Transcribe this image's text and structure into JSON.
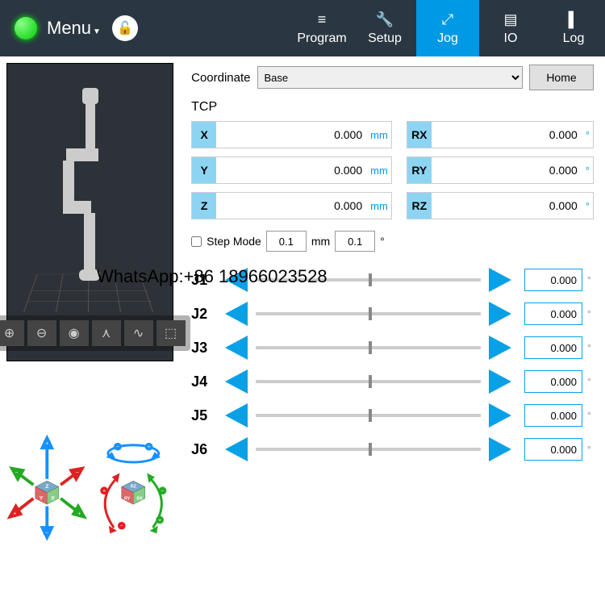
{
  "header": {
    "menu_label": "Menu",
    "tabs": [
      {
        "id": "program",
        "label": "Program",
        "icon": "≡"
      },
      {
        "id": "setup",
        "label": "Setup",
        "icon": "🔧"
      },
      {
        "id": "jog",
        "label": "Jog",
        "icon": "⤢",
        "active": true
      },
      {
        "id": "io",
        "label": "IO",
        "icon": "▤"
      },
      {
        "id": "log",
        "label": "Log",
        "icon": "▌"
      }
    ]
  },
  "coordinate": {
    "label": "Coordinate",
    "selected": "Base",
    "home_label": "Home"
  },
  "tcp": {
    "label": "TCP",
    "fields": [
      {
        "axis": "X",
        "value": "0.000",
        "unit": "mm"
      },
      {
        "axis": "RX",
        "value": "0.000",
        "unit": "°"
      },
      {
        "axis": "Y",
        "value": "0.000",
        "unit": "mm"
      },
      {
        "axis": "RY",
        "value": "0.000",
        "unit": "°"
      },
      {
        "axis": "Z",
        "value": "0.000",
        "unit": "mm"
      },
      {
        "axis": "RZ",
        "value": "0.000",
        "unit": "°"
      }
    ]
  },
  "step": {
    "label": "Step Mode",
    "linear": "0.1",
    "linear_unit": "mm",
    "angular": "0.1",
    "angular_unit": "°"
  },
  "joints": [
    {
      "name": "J1",
      "value": "0.000"
    },
    {
      "name": "J2",
      "value": "0.000"
    },
    {
      "name": "J3",
      "value": "0.000"
    },
    {
      "name": "J4",
      "value": "0.000"
    },
    {
      "name": "J5",
      "value": "0.000"
    },
    {
      "name": "J6",
      "value": "0.000"
    }
  ],
  "watermark": "WhatsApp:+86 18966023528",
  "viewer_tools": [
    "zoom-in",
    "zoom-out",
    "reset-view",
    "axes",
    "path",
    "fit"
  ]
}
